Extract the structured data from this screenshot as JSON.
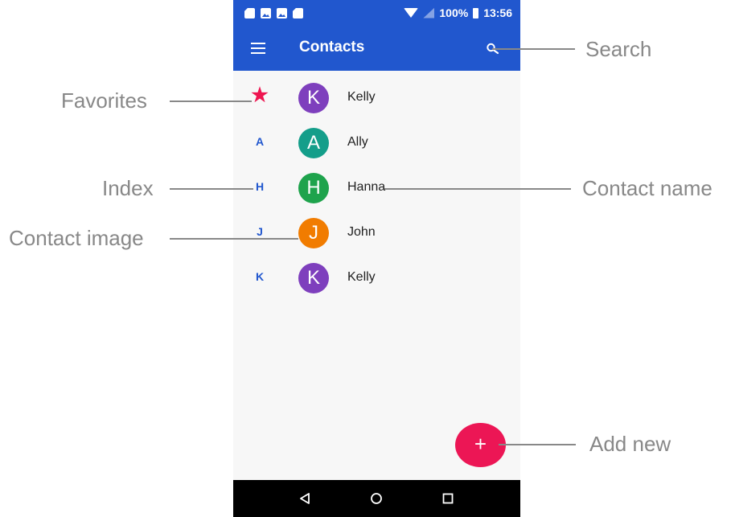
{
  "status_bar": {
    "battery": "100%",
    "time": "13:56"
  },
  "app_bar": {
    "title": "Contacts"
  },
  "contacts": [
    {
      "index": "★",
      "name": "Kelly",
      "initial": "K",
      "color": "#7e3fbd"
    },
    {
      "index": "A",
      "name": "Ally",
      "initial": "A",
      "color": "#149e8a"
    },
    {
      "index": "H",
      "name": "Hanna",
      "initial": "H",
      "color": "#1ea34c"
    },
    {
      "index": "J",
      "name": "John",
      "initial": "J",
      "color": "#f17c00"
    },
    {
      "index": "K",
      "name": "Kelly",
      "initial": "K",
      "color": "#7e3fbd"
    }
  ],
  "fab": {
    "label": "+"
  },
  "annotations": {
    "search": "Search",
    "favorites": "Favorites",
    "index": "Index",
    "contact_name": "Contact name",
    "contact_image": "Contact image",
    "add_new": "Add new"
  },
  "colors": {
    "primary": "#2157ce",
    "accent": "#ec1655",
    "index_text": "#2157ce",
    "favorite_star": "#ee1550"
  }
}
